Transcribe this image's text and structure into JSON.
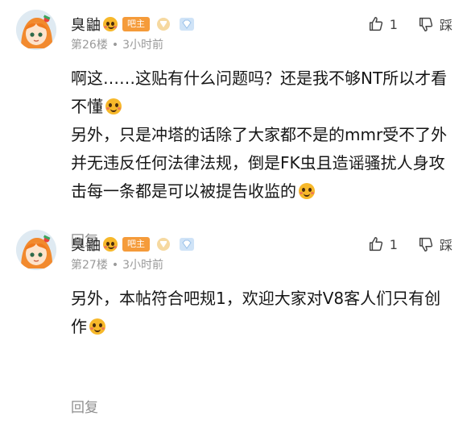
{
  "posts": [
    {
      "username": "臭鼬",
      "badge": "吧主",
      "floor": "第26楼",
      "time": "3小时前",
      "like_count": "1",
      "report_label": "踩",
      "content": [
        "啊这……这贴有什么问题吗？还是我不够NT所以才看不懂",
        "另外，只是冲塔的话除了大家都不是的mmr受不了外并无违反任何法律法规，倒是FK虫且造谣骚扰人身攻击每一条都是可以被提告收监的"
      ],
      "reply_label": "回复"
    },
    {
      "username": "臭鼬",
      "badge": "吧主",
      "floor": "第27楼",
      "time": "3小时前",
      "like_count": "1",
      "report_label": "踩",
      "content": [
        "另外，本帖符合吧规1，欢迎大家对V8客人们只有创作"
      ],
      "reply_label": "回复"
    }
  ],
  "separator": "•",
  "colors": {
    "badge_bg": "#f59b3a",
    "meta_text": "#9a9a9a",
    "emoji": "#f7b82a"
  },
  "icons": {
    "like": "thumbs-up-icon",
    "report": "thumbs-down-icon",
    "level": "level-badge-icon",
    "vip": "vip-diamond-icon",
    "emoji": "smile-emoji-icon"
  }
}
